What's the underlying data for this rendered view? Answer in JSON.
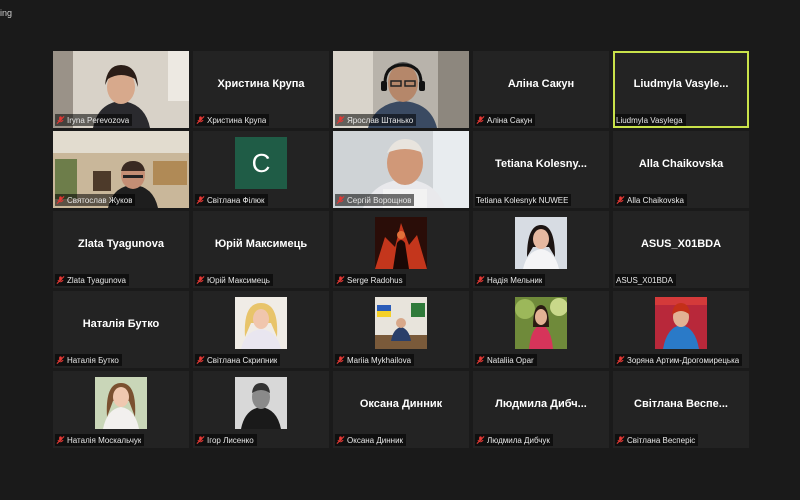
{
  "window": {
    "top_label": "ing"
  },
  "participants": [
    {
      "display": "video",
      "label": "Iryna Perevozova",
      "muted": true
    },
    {
      "display": "Христина Крупа",
      "label": "Христина Крупа",
      "muted": true
    },
    {
      "display": "video",
      "label": "Ярослав Штанько",
      "muted": true
    },
    {
      "display": "Аліна Сакун",
      "label": "Аліна Сакун",
      "muted": true
    },
    {
      "display": "Liudmyla Vasyle...",
      "label": "Liudmyla Vasylega",
      "muted": false,
      "active_speaker": true
    },
    {
      "display": "video",
      "label": "Святослав Жуков",
      "muted": true
    },
    {
      "display": "avatar",
      "avatar_letter": "C",
      "label": "Світлана Філюк",
      "muted": true
    },
    {
      "display": "video",
      "label": "Сергій Ворощнов",
      "muted": true
    },
    {
      "display": "Tetiana Kolesny...",
      "label": "Tetiana Kolesnyk NUWEE",
      "muted": false
    },
    {
      "display": "Alla Chaikovska",
      "label": "Alla Chaikovska",
      "muted": true
    },
    {
      "display": "Zlata Tyagunova",
      "label": "Zlata Tyagunova",
      "muted": true
    },
    {
      "display": "Юрій Максимець",
      "label": "Юрій Максимець",
      "muted": true
    },
    {
      "display": "photo",
      "label": "Serge Radohus",
      "muted": true
    },
    {
      "display": "photo",
      "label": "Надія Мельник",
      "muted": true
    },
    {
      "display": "ASUS_X01BDA",
      "label": "ASUS_X01BDA",
      "muted": false
    },
    {
      "display": "Наталія Бутко",
      "label": "Наталія Бутко",
      "muted": true
    },
    {
      "display": "photo",
      "label": "Світлана Скрипник",
      "muted": true
    },
    {
      "display": "photo",
      "label": "Mariia Mykhailova",
      "muted": true
    },
    {
      "display": "photo",
      "label": "Nataliia Opar",
      "muted": true
    },
    {
      "display": "photo",
      "label": "Зоряна Артим-Дрогомирецька",
      "muted": true
    },
    {
      "display": "photo",
      "label": "Наталія Москальчук",
      "muted": true
    },
    {
      "display": "photo",
      "label": "Ігор Лисенко",
      "muted": true
    },
    {
      "display": "Оксана Динник",
      "label": "Оксана Динник",
      "muted": true
    },
    {
      "display": "Людмила Дибч...",
      "label": "Людмила Дибчук",
      "muted": true
    },
    {
      "display": "Світлана Веспе...",
      "label": "Світлана Весперіс",
      "muted": true
    }
  ],
  "colors": {
    "active_border": "#c9e24a",
    "tile_bg": "#232323",
    "mute_red": "#e53935",
    "avatar_green": "#1f5c46"
  }
}
